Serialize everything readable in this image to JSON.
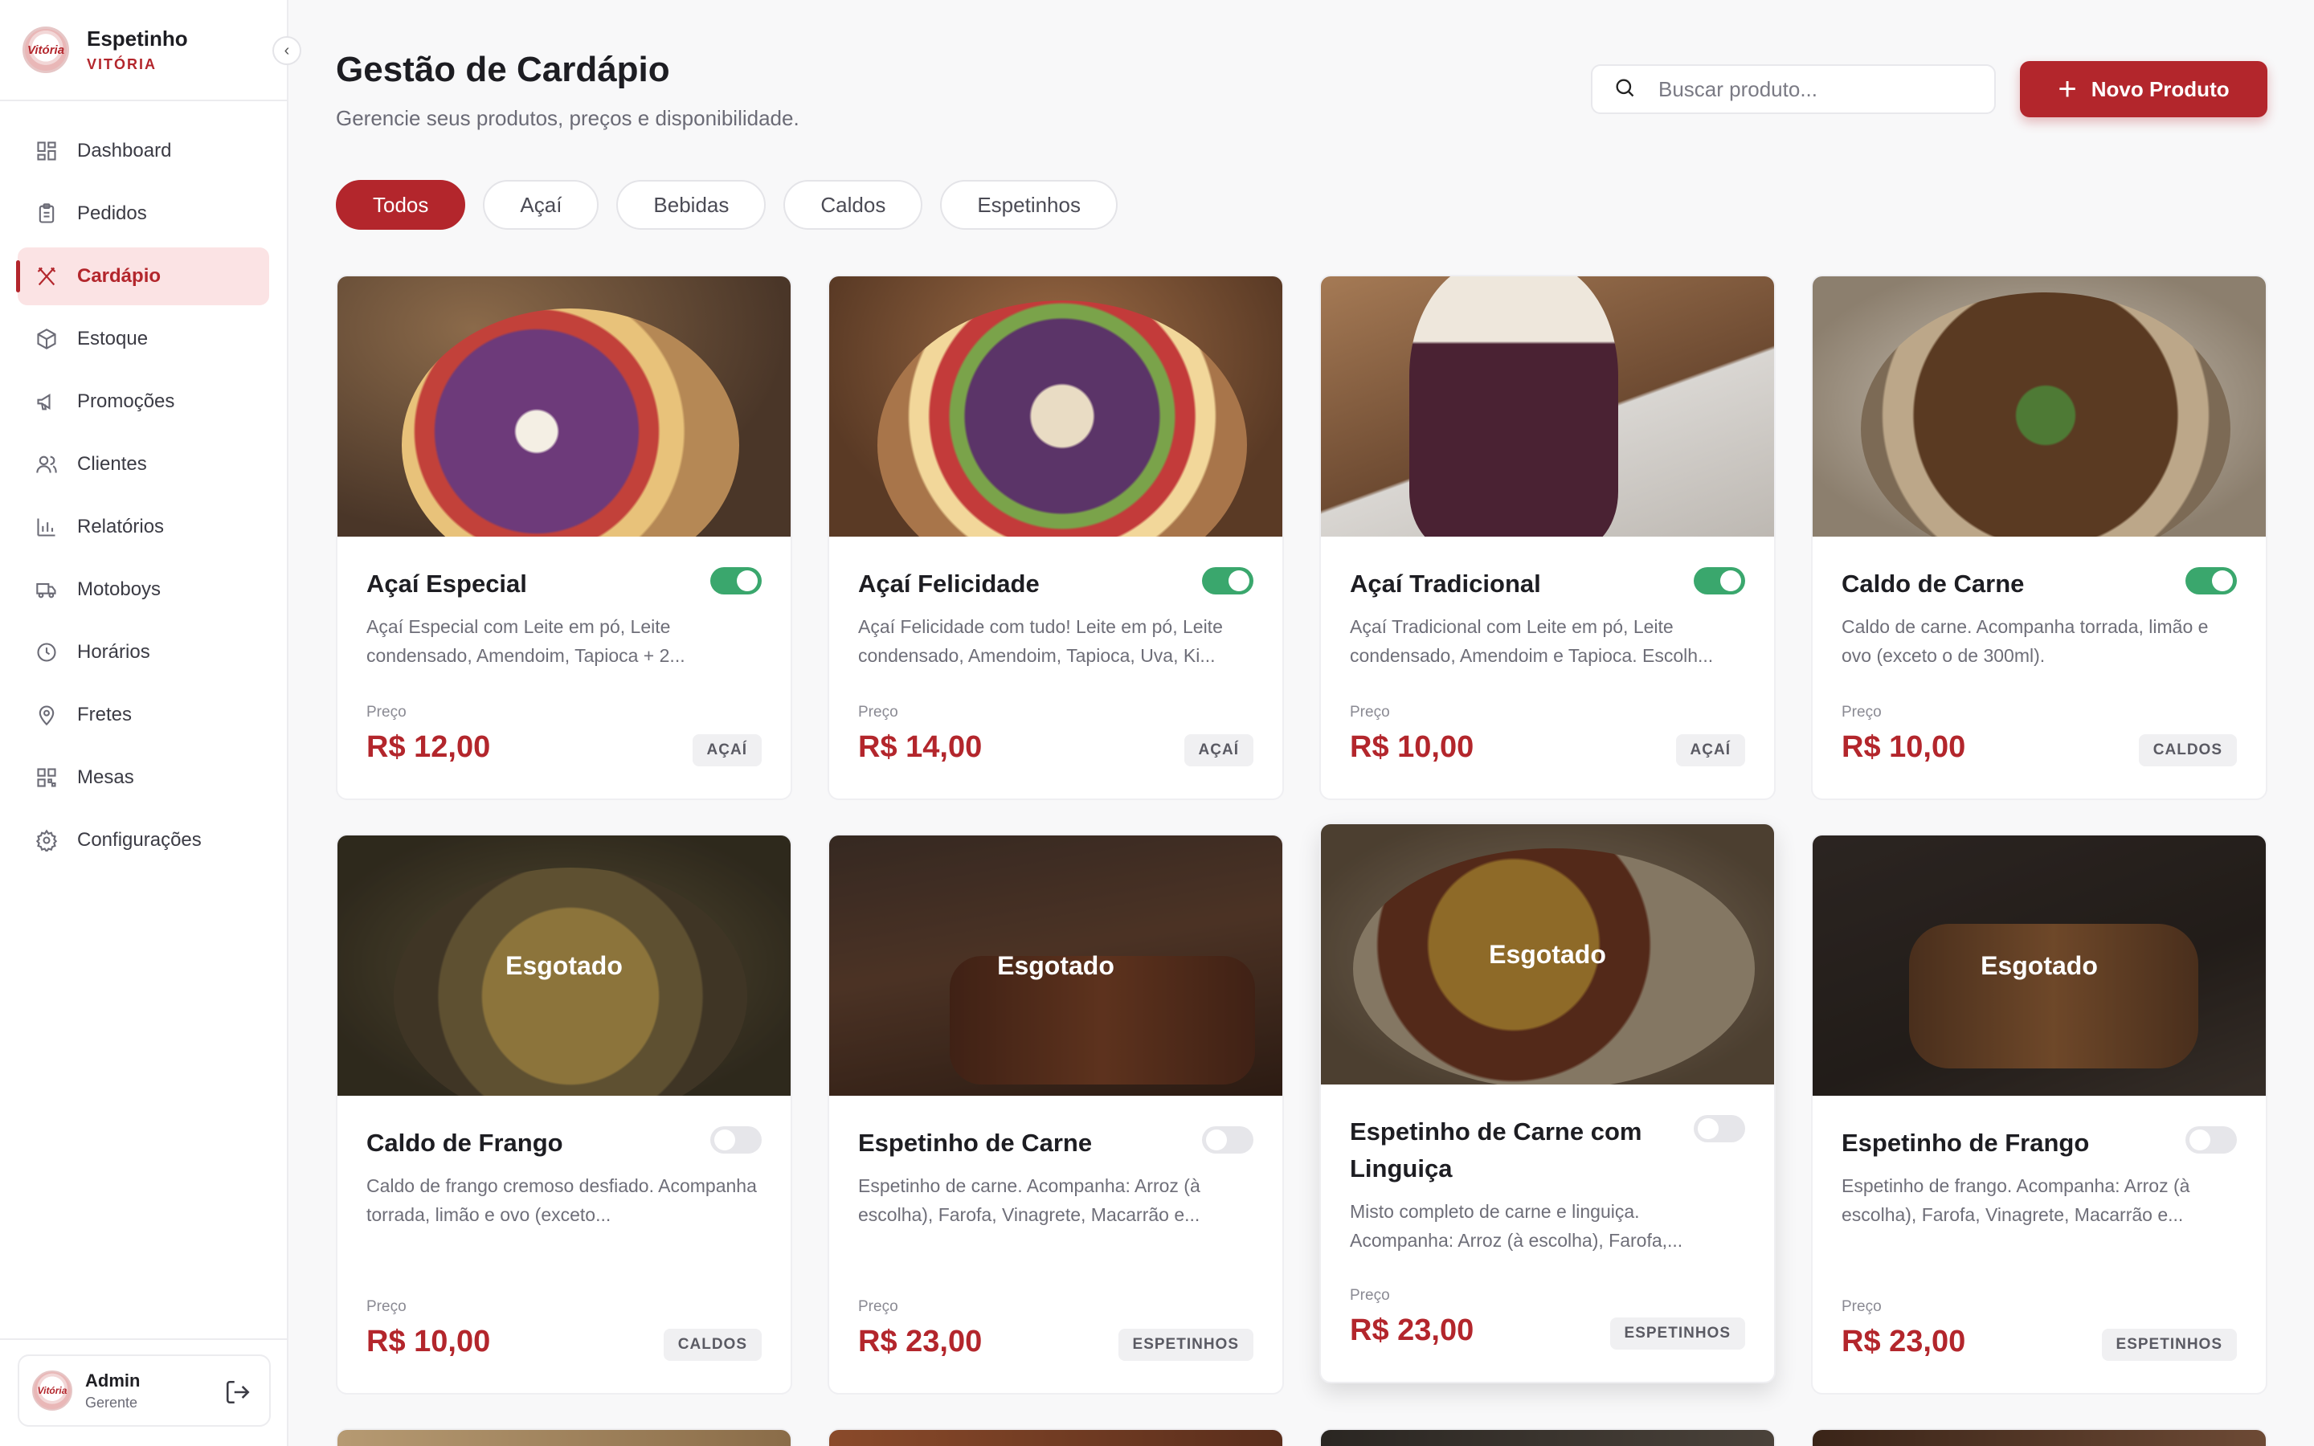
{
  "brand": {
    "name": "Espetinho",
    "subtitle": "VITÓRIA",
    "logo_text": "Vitória"
  },
  "nav": [
    {
      "label": "Dashboard",
      "icon": "dashboard-icon"
    },
    {
      "label": "Pedidos",
      "icon": "clipboard-icon"
    },
    {
      "label": "Cardápio",
      "icon": "utensils-icon",
      "active": true
    },
    {
      "label": "Estoque",
      "icon": "box-icon"
    },
    {
      "label": "Promoções",
      "icon": "megaphone-icon"
    },
    {
      "label": "Clientes",
      "icon": "users-icon"
    },
    {
      "label": "Relatórios",
      "icon": "bar-chart-icon"
    },
    {
      "label": "Motoboys",
      "icon": "truck-icon"
    },
    {
      "label": "Horários",
      "icon": "clock-icon"
    },
    {
      "label": "Fretes",
      "icon": "map-pin-icon"
    },
    {
      "label": "Mesas",
      "icon": "qr-code-icon"
    },
    {
      "label": "Configurações",
      "icon": "gear-icon"
    }
  ],
  "user": {
    "name": "Admin",
    "role": "Gerente"
  },
  "header": {
    "title": "Gestão de Cardápio",
    "subtitle": "Gerencie seus produtos, preços e disponibilidade.",
    "search_placeholder": "Buscar produto...",
    "new_button": "Novo Produto"
  },
  "tabs": [
    "Todos",
    "Açaí",
    "Bebidas",
    "Caldos",
    "Espetinhos"
  ],
  "price_label": "Preço",
  "sold_out_label": "Esgotado",
  "products": [
    {
      "name": "Açaí Especial",
      "desc": "Açaí Especial com Leite em pó, Leite condensado, Amendoim, Tapioca + 2...",
      "price": "R$ 12,00",
      "category": "AÇAÍ",
      "available": true
    },
    {
      "name": "Açaí Felicidade",
      "desc": "Açaí Felicidade com tudo! Leite em pó, Leite condensado, Amendoim, Tapioca, Uva, Ki...",
      "price": "R$ 14,00",
      "category": "AÇAÍ",
      "available": true
    },
    {
      "name": "Açaí Tradicional",
      "desc": "Açaí Tradicional com Leite em pó, Leite condensado, Amendoim e Tapioca. Escolh...",
      "price": "R$ 10,00",
      "category": "AÇAÍ",
      "available": true
    },
    {
      "name": "Caldo de Carne",
      "desc": "Caldo de carne. Acompanha torrada, limão e ovo (exceto o de 300ml).",
      "price": "R$ 10,00",
      "category": "CALDOS",
      "available": true
    },
    {
      "name": "Caldo de Frango",
      "desc": "Caldo de frango cremoso desfiado. Acompanha torrada, limão e ovo (exceto...",
      "price": "R$ 10,00",
      "category": "CALDOS",
      "available": false
    },
    {
      "name": "Espetinho de Carne",
      "desc": "Espetinho de carne. Acompanha: Arroz (à escolha), Farofa, Vinagrete, Macarrão e...",
      "price": "R$ 23,00",
      "category": "ESPETINHOS",
      "available": false
    },
    {
      "name": "Espetinho de Carne com Linguiça",
      "desc": "Misto completo de carne e linguiça. Acompanha: Arroz (à escolha), Farofa,...",
      "price": "R$ 23,00",
      "category": "ESPETINHOS",
      "available": false
    },
    {
      "name": "Espetinho de Frango",
      "desc": "Espetinho de frango. Acompanha: Arroz (à escolha), Farofa, Vinagrete, Macarrão e...",
      "price": "R$ 23,00",
      "category": "ESPETINHOS",
      "available": false
    }
  ]
}
